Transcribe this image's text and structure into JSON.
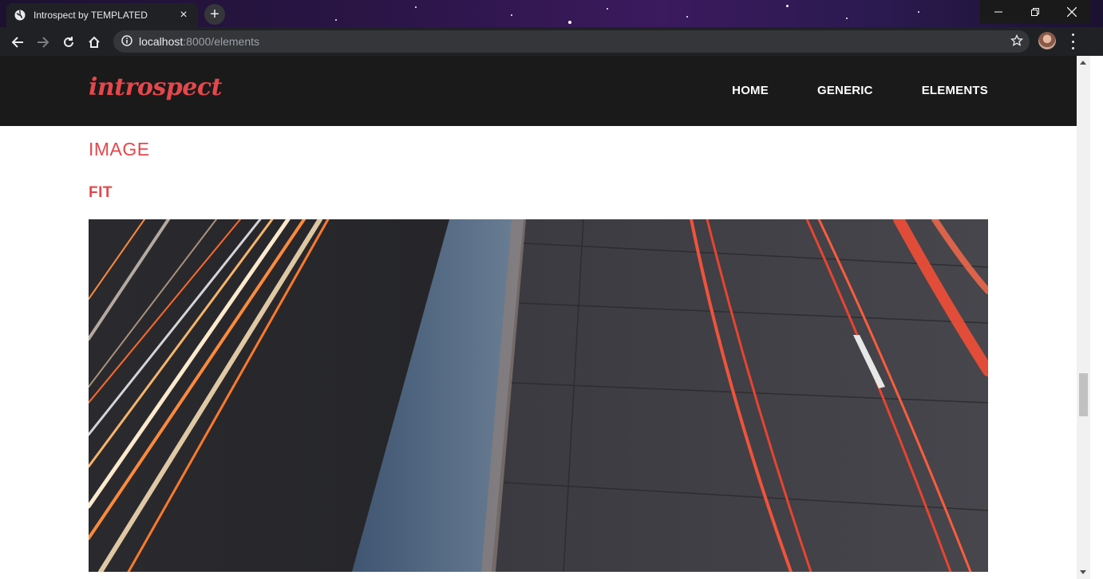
{
  "browser": {
    "tab_title": "Introspect by TEMPLATED",
    "url_host": "localhost",
    "url_path": ":8000/elements"
  },
  "site": {
    "logo": "introspect",
    "nav": [
      {
        "label": "HOME"
      },
      {
        "label": "GENERIC"
      },
      {
        "label": "ELEMENTS"
      }
    ]
  },
  "content": {
    "section_heading": "IMAGE",
    "sub_heading": "FIT"
  },
  "colors": {
    "accent": "#e5474b",
    "header_bg": "#1a1a1a",
    "chrome_bg": "#202124"
  },
  "icons": [
    "globe-icon",
    "close-icon",
    "plus-icon",
    "minimize-icon",
    "restore-icon",
    "window-close-icon",
    "back-icon",
    "forward-icon",
    "reload-icon",
    "home-icon",
    "info-icon",
    "bookmark-star-icon",
    "profile-avatar",
    "menu-icon"
  ]
}
